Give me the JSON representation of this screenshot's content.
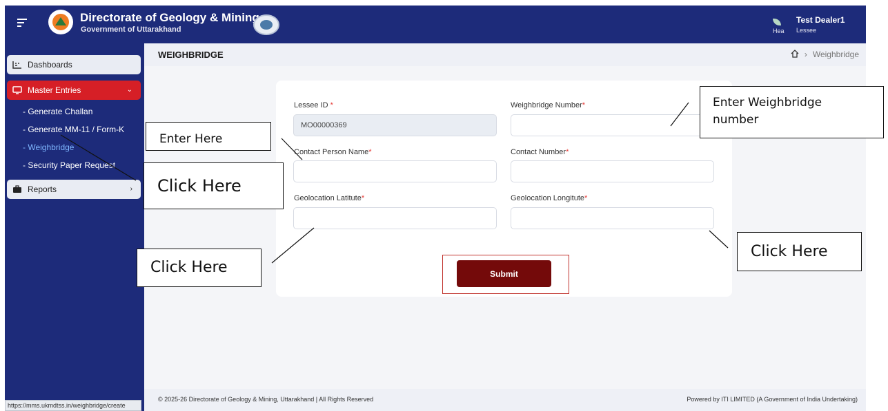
{
  "header": {
    "title": "Directorate of Geology & Mining",
    "subtitle": "Government of Uttarakhand",
    "user_name": "Test Dealer1",
    "user_role": "Lessee",
    "avatar_alt": "Hea",
    "colors": {
      "header_bg": "#1d2b7a",
      "accent_red": "#d61f26",
      "submit_bg": "#740a0a"
    }
  },
  "sidebar": {
    "dashboards": "Dashboards",
    "master_entries": "Master Entries",
    "sub_items": [
      "- Generate Challan",
      "- Generate MM-11 / Form-K",
      "- Weighbridge",
      "- Security Paper Request"
    ],
    "reports": "Reports"
  },
  "page": {
    "title": "WEIGHBRIDGE",
    "breadcrumb": "Weighbridge"
  },
  "form": {
    "lessee_id_label": "Lessee ID ",
    "lessee_id_value": "MO00000369",
    "weighbridge_number_label": "Weighbridge Number",
    "contact_person_label": "Contact Person Name",
    "contact_number_label": "Contact Number",
    "latitude_label": "Geolocation Latitute",
    "longitude_label": "Geolocation Longitute",
    "required_mark": "*",
    "submit_label": "Submit"
  },
  "footer": {
    "left": "© 2025-26 Directorate of Geology & Mining, Uttarakhand | All Rights Reserved",
    "right": "Powered by ITI LIMITED (A Government of India Undertaking)",
    "status_url": "https://mms.ukmdtss.in/weighbridge/create"
  },
  "annotations": {
    "enter_here": "Enter Here",
    "click_here_1": "Click Here",
    "click_here_2": "Click Here",
    "click_here_3": "Click Here",
    "enter_weighbridge_1": "Enter Weighbridge",
    "enter_weighbridge_2": "number"
  }
}
